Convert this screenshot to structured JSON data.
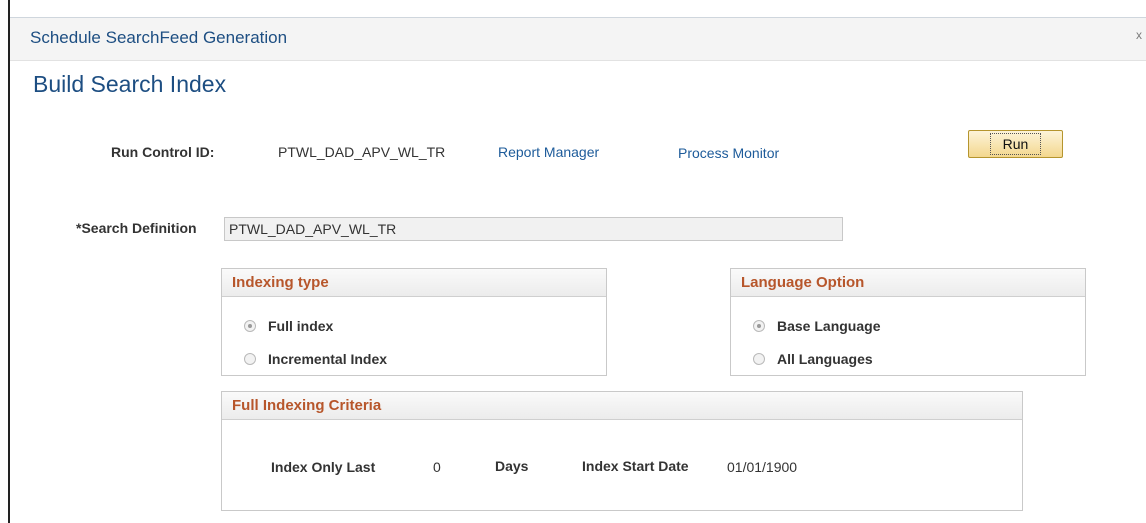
{
  "window": {
    "title": "Schedule SearchFeed Generation",
    "close_glyph": "x"
  },
  "page": {
    "title": "Build Search Index"
  },
  "run_control": {
    "label": "Run Control ID:",
    "value": "PTWL_DAD_APV_WL_TR",
    "report_manager_link": "Report Manager",
    "process_monitor_link": "Process Monitor",
    "run_button": "Run"
  },
  "search_definition": {
    "label": "*Search Definition",
    "value": "PTWL_DAD_APV_WL_TR"
  },
  "indexing_type": {
    "title": "Indexing type",
    "options": [
      {
        "label": "Full index",
        "selected": true
      },
      {
        "label": "Incremental Index",
        "selected": false
      }
    ]
  },
  "language_option": {
    "title": "Language Option",
    "options": [
      {
        "label": "Base Language",
        "selected": true
      },
      {
        "label": "All Languages",
        "selected": false
      }
    ]
  },
  "full_indexing_criteria": {
    "title": "Full Indexing Criteria",
    "index_only_last_label": "Index Only Last",
    "index_only_last_value": "0",
    "days_label": "Days",
    "index_start_date_label": "Index Start Date",
    "index_start_date_value": "01/01/1900"
  },
  "colors": {
    "link": "#1d5b9a",
    "group_title": "#b7562b",
    "heading": "#1d4e82",
    "button": "#f3d78e"
  }
}
